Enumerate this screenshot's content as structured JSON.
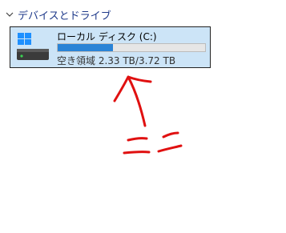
{
  "section": {
    "title": "デバイスとドライブ",
    "chevron_icon": "chevron-down-icon"
  },
  "drive": {
    "name": "ローカル ディスク (C:)",
    "space_text": "空き領域 2.33 TB/3.72 TB",
    "used_fraction": 0.374,
    "icon": "windows-drive-icon",
    "colors": {
      "tile_bg": "#cce4f7",
      "bar_fill": "#2a83d6",
      "bar_bg": "#e6e6e6"
    }
  },
  "annotation": {
    "text": "ここ",
    "color": "#e01010"
  }
}
